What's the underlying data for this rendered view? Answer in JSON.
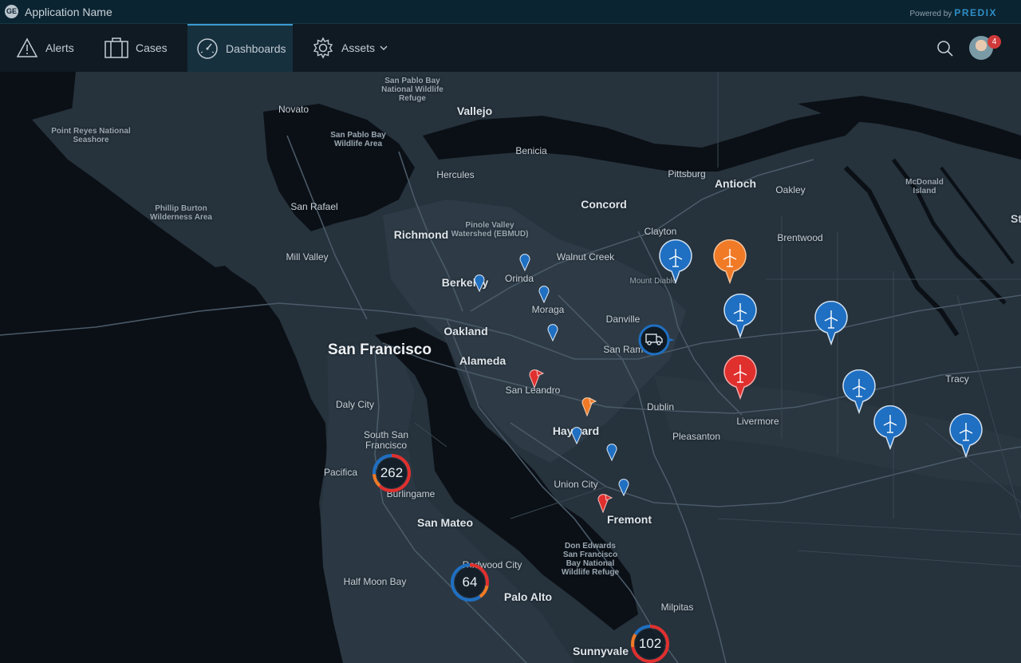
{
  "topbar": {
    "app_name": "Application Name",
    "logo_text": "GE",
    "powered_by": "Powered by",
    "brand": "PREDIX"
  },
  "nav": {
    "items": [
      {
        "label": "Alerts",
        "icon": "warning-icon"
      },
      {
        "label": "Cases",
        "icon": "briefcase-icon"
      },
      {
        "label": "Dashboards",
        "icon": "dashboard-icon",
        "active": true
      },
      {
        "label": "Assets",
        "icon": "gear-icon",
        "dropdown": true
      }
    ],
    "notification_count": "4"
  },
  "colors": {
    "accent": "#3c9bd0",
    "marker_blue": "#1f6fc2",
    "marker_orange": "#f07a26",
    "marker_red": "#e0302e",
    "water": "#0b1016",
    "land": "#26323c"
  },
  "map": {
    "labels": {
      "san_francisco": "San Francisco",
      "oakland": "Oakland",
      "alameda": "Alameda",
      "richmond": "Richmond",
      "berkeley": "Berkeley",
      "vallejo": "Vallejo",
      "concord": "Concord",
      "antioch": "Antioch",
      "hayward": "Hayward",
      "fremont": "Fremont",
      "san_mateo": "San Mateo",
      "palo_alto": "Palo Alto",
      "sunnyvale": "Sunnyvale",
      "novato": "Novato",
      "benicia": "Benicia",
      "hercules": "Hercules",
      "pittsburg": "Pittsburg",
      "oakley": "Oakley",
      "brentwood": "Brentwood",
      "clayton": "Clayton",
      "walnut_creek": "Walnut Creek",
      "orinda": "Orinda",
      "moraga": "Moraga",
      "danville": "Danville",
      "san_ramon": "San Ramon",
      "san_leandro": "San Leandro",
      "dublin": "Dublin",
      "pleasanton": "Pleasanton",
      "livermore": "Livermore",
      "tracy": "Tracy",
      "daly_city": "Daly City",
      "south_san_francisco": "South San Francisco",
      "pacifica": "Pacifica",
      "burlingame": "Burlingame",
      "union_city": "Union City",
      "redwood_city": "Redwood City",
      "half_moon_bay": "Half Moon Bay",
      "milpitas": "Milpitas",
      "san_rafael": "San Rafael",
      "mill_valley": "Mill Valley",
      "mount_diablo": "Mount Diablo",
      "edge_st": "St",
      "park_san_pablo_refuge": "San Pablo Bay National Wildlife Refuge",
      "park_san_pablo_bay": "San Pablo Bay Wildlife Area",
      "park_point_reyes": "Point Reyes National Seashore",
      "park_phillip_burton": "Phillip Burton Wilderness Area",
      "park_pinole_valley": "Pinole Valley Watershed (EBMUD)",
      "park_mcdonald": "McDonald Island",
      "park_don_edwards": "Don Edwards San Francisco Bay National Wildlife Refuge"
    },
    "clusters": [
      {
        "count": "262",
        "red_fraction": 0.62
      },
      {
        "count": "64",
        "red_fraction": 0.28
      },
      {
        "count": "102",
        "red_fraction": 0.72
      }
    ],
    "wind_markers": [
      "blue",
      "orange",
      "blue",
      "blue",
      "red",
      "blue",
      "blue",
      "blue"
    ],
    "small_pins": [
      "blue",
      "blue",
      "blue",
      "blue",
      "blue",
      "blue",
      "blue"
    ],
    "flag_markers": [
      "red",
      "orange",
      "red"
    ],
    "truck_marker": "truck-icon"
  }
}
